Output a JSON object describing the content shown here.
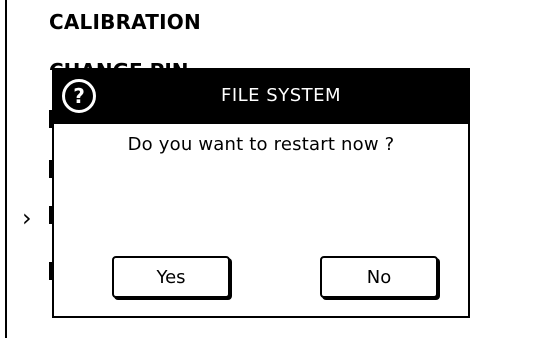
{
  "menu": {
    "title": "CALIBRATION",
    "hidden_item": "CHANGE PIN",
    "selected_indicator": "›"
  },
  "dialog": {
    "icon": "help-icon",
    "icon_glyph": "?",
    "title": "FILE SYSTEM",
    "message": "Do you want to restart now ?",
    "buttons": {
      "yes": "Yes",
      "no": "No"
    }
  }
}
